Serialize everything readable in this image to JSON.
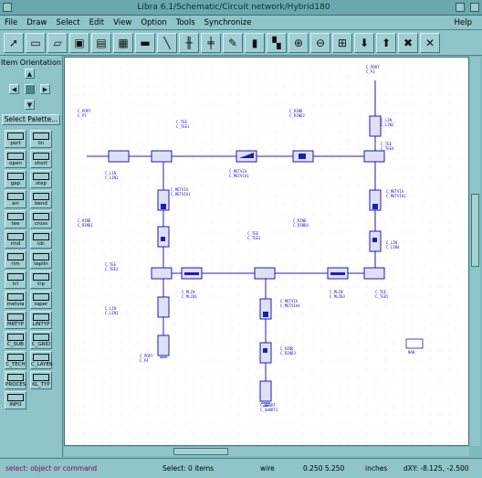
{
  "window": {
    "title": "Libra 6.1/Schematic/Circuit network/Hybrid180"
  },
  "menu": {
    "items": [
      "File",
      "Draw",
      "Select",
      "Edit",
      "View",
      "Option",
      "Tools",
      "Synchronize"
    ],
    "help": "Help"
  },
  "toolbar": {
    "icons": [
      "select-arrow-icon",
      "open-folder-icon",
      "open-file-icon",
      "save-icon",
      "save-as-icon",
      "print-icon",
      "chip-icon",
      "line-icon",
      "rotate-icon",
      "mirror-icon",
      "edit-icon",
      "delete-icon",
      "move-icon",
      "zoom-in-icon",
      "zoom-out-icon",
      "fit-icon",
      "download-icon",
      "upload-icon",
      "cut-icon",
      "break-icon"
    ]
  },
  "palette": {
    "orientation_label": "Item Orientation",
    "select_palette_label": "Select Palette...",
    "items": [
      {
        "label": "port"
      },
      {
        "label": "lin"
      },
      {
        "label": "open"
      },
      {
        "label": "short"
      },
      {
        "label": "gap"
      },
      {
        "label": "step"
      },
      {
        "label": "arr"
      },
      {
        "label": "bend"
      },
      {
        "label": "tee"
      },
      {
        "label": "cross"
      },
      {
        "label": "rind"
      },
      {
        "label": "idc"
      },
      {
        "label": "rim"
      },
      {
        "label": "taplin"
      },
      {
        "label": "trl"
      },
      {
        "label": "trp"
      },
      {
        "label": "metvia"
      },
      {
        "label": "taper"
      },
      {
        "label": "MRTYP"
      },
      {
        "label": "LINTYP"
      },
      {
        "label": "C_SUB"
      },
      {
        "label": "C_GRID"
      },
      {
        "label": "C_TECH"
      },
      {
        "label": "C_LAYER"
      },
      {
        "label": "PROCES"
      },
      {
        "label": "KL_TYP"
      },
      {
        "label": "INFO"
      }
    ]
  },
  "status": {
    "prompt": "select: object or command",
    "select_count": "Select: 0 items",
    "mode": "wire",
    "coords": "0.250 5.250",
    "units": "inches",
    "delta": "dXY:  -8.125, -2.500"
  },
  "canvas": {
    "labels": [
      "C_PORT",
      "C_P1",
      "C_TEE",
      "C_TEE1",
      "C_LIN",
      "C_LIN1",
      "C_METVIA",
      "C_METVIA1",
      "C_RIND",
      "C_RIND1",
      "C_RIND2",
      "C_TEE2",
      "C_TEE3",
      "C_LIN2",
      "C_RIND3",
      "C_RIND4",
      "C_MTAPER",
      "C_P2",
      "C_P3",
      "C_P4",
      "C_SHORT",
      "C_SHORT1",
      "C_TEE4",
      "C_TEE5",
      "C_METVIA2",
      "C_METVIA3",
      "C_METVIA4",
      "C_LIN3",
      "C_LIN4",
      "C_LIN5",
      "C_MLIN1",
      "C_MLIN2",
      "C_MLIN3",
      "NAB"
    ]
  }
}
